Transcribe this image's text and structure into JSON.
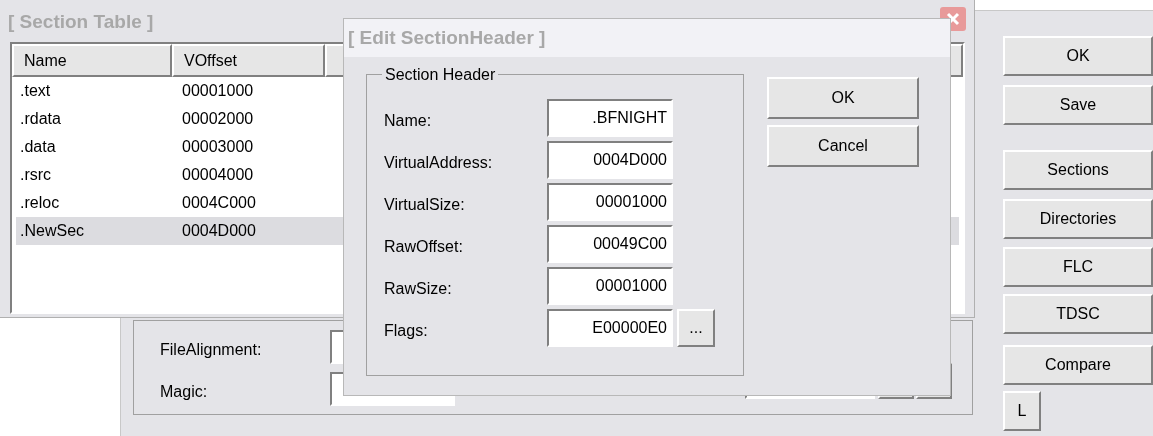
{
  "main_window": {
    "buttons": [
      "OK",
      "Save",
      "Sections",
      "Directories",
      "FLC",
      "TDSC",
      "Compare",
      "L"
    ],
    "fields": [
      {
        "label": "FileAlignment:"
      },
      {
        "label": "Magic:"
      }
    ]
  },
  "section_table": {
    "title": "[ Section Table ]",
    "columns": [
      "Name",
      "VOffset"
    ],
    "rows": [
      {
        "name": ".text",
        "voffset": "00001000",
        "selected": false
      },
      {
        "name": ".rdata",
        "voffset": "00002000",
        "selected": false
      },
      {
        "name": ".data",
        "voffset": "00003000",
        "selected": false
      },
      {
        "name": ".rsrc",
        "voffset": "00004000",
        "selected": false
      },
      {
        "name": ".reloc",
        "voffset": "0004C000",
        "selected": false
      },
      {
        "name": ".NewSec",
        "voffset": "0004D000",
        "selected": true
      }
    ]
  },
  "edit_dialog": {
    "title": "[ Edit SectionHeader ]",
    "group_title": "Section Header",
    "fields": [
      {
        "label": "Name:",
        "value": ".BFNIGHT"
      },
      {
        "label": "VirtualAddress:",
        "value": "0004D000"
      },
      {
        "label": "VirtualSize:",
        "value": "00001000"
      },
      {
        "label": "RawOffset:",
        "value": "00049C00"
      },
      {
        "label": "RawSize:",
        "value": "00001000"
      },
      {
        "label": "Flags:",
        "value": "E00000E0",
        "browse": "..."
      }
    ],
    "buttons": [
      "OK",
      "Cancel"
    ]
  }
}
